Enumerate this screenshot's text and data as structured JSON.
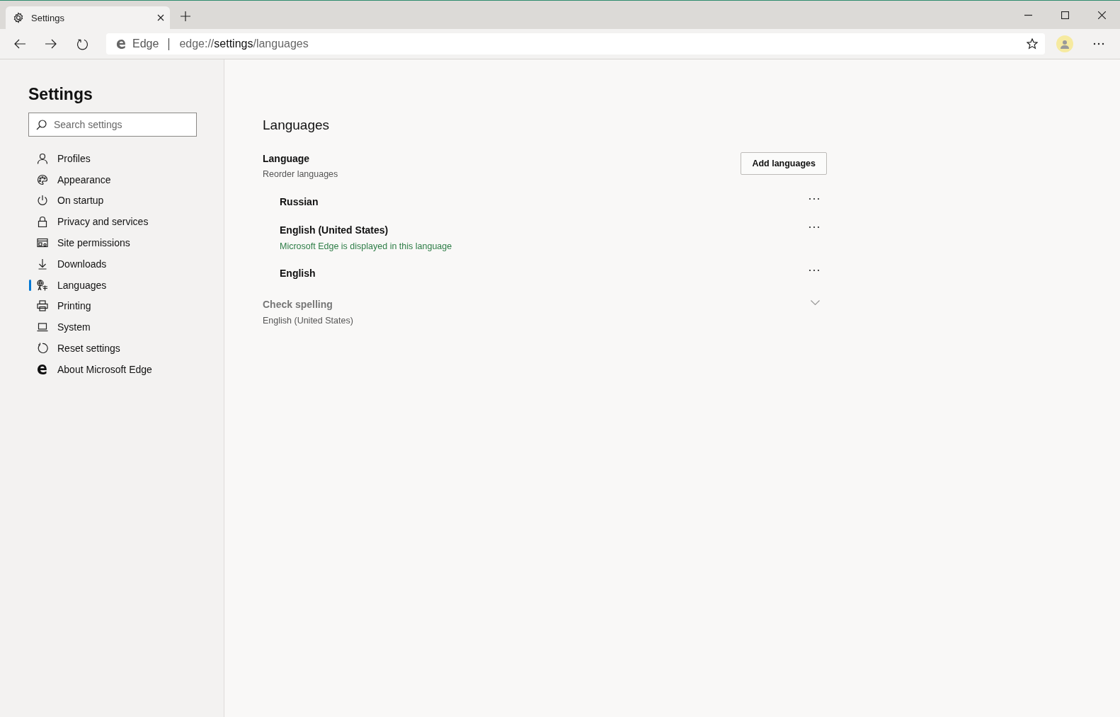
{
  "tab": {
    "title": "Settings",
    "selected": true
  },
  "address": {
    "brand": "Edge",
    "scheme": "edge://",
    "host": "settings",
    "path": "/languages"
  },
  "sidebar": {
    "title": "Settings",
    "search": {
      "placeholder": "Search settings"
    },
    "items": [
      {
        "label": "Profiles",
        "selected": false
      },
      {
        "label": "Appearance",
        "selected": false
      },
      {
        "label": "On startup",
        "selected": false
      },
      {
        "label": "Privacy and services",
        "selected": false
      },
      {
        "label": "Site permissions",
        "selected": false
      },
      {
        "label": "Downloads",
        "selected": false
      },
      {
        "label": "Languages",
        "selected": true
      },
      {
        "label": "Printing",
        "selected": false
      },
      {
        "label": "System",
        "selected": false
      },
      {
        "label": "Reset settings",
        "selected": false
      },
      {
        "label": "About Microsoft Edge",
        "selected": false
      }
    ]
  },
  "main": {
    "title": "Languages",
    "language": {
      "label": "Language",
      "hint": "Reorder languages",
      "button": "Add languages",
      "items": [
        {
          "name": "Russian"
        },
        {
          "name": "English (United States)",
          "note": "Microsoft Edge is displayed in this language"
        },
        {
          "name": "English"
        }
      ]
    },
    "spelling": {
      "label": "Check spelling",
      "value": "English (United States)",
      "disabled": true
    }
  }
}
